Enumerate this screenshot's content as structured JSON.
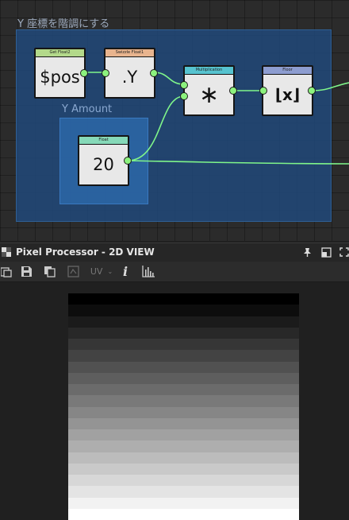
{
  "graph": {
    "frame_title": "Y 座標を階調にする",
    "subframe_title": "Y Amount",
    "nodes": {
      "get_float2": {
        "header": "Get Float2",
        "header_color": "#b3d98a",
        "value": "$pos"
      },
      "swizzle": {
        "header": "Swizzle Float1",
        "header_color": "#e8b48e",
        "value": ".Y"
      },
      "multiplication": {
        "header": "Multiplication",
        "header_color": "#56c3cf",
        "value": "∗"
      },
      "floor": {
        "header": "Floor",
        "header_color": "#8d9dd0",
        "value": "⌊x⌋"
      },
      "float": {
        "header": "Float",
        "header_color": "#86d9b8",
        "value": "20"
      }
    },
    "wire_color": "#7ff58a"
  },
  "panel": {
    "title": "Pixel Processor - 2D VIEW",
    "toolbar": {
      "uv_label": "UV",
      "icons": [
        "window-icon",
        "save-icon",
        "copy-icon",
        "tile-icon",
        "uv-dropdown",
        "info-icon",
        "histogram-icon"
      ]
    },
    "title_icons": [
      "pin-icon",
      "float-window-icon",
      "maximize-icon"
    ]
  },
  "preview": {
    "steps": 20,
    "description_values": "vertical stepped grayscale gradient, dark at top to light at bottom"
  }
}
